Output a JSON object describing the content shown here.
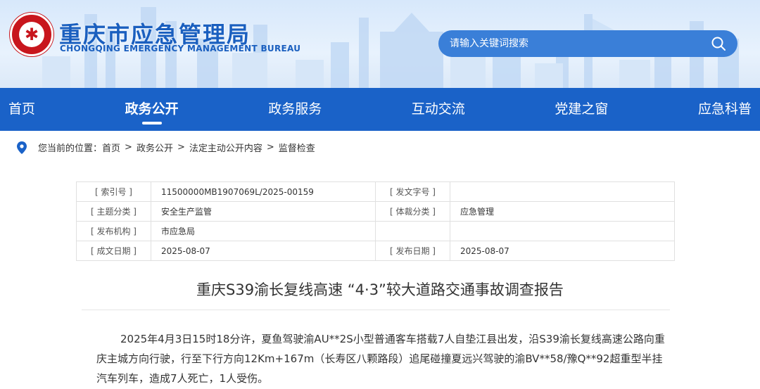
{
  "header": {
    "logo_icon": "emergency-management-emblem",
    "title": "重庆市应急管理局",
    "subtitle": "CHONGQING EMERGENCY MANAGEMENT BUREAU",
    "search_placeholder": "请输入关键词搜索",
    "search_icon": "search-icon"
  },
  "nav": {
    "items": [
      {
        "label": "首页"
      },
      {
        "label": "政务公开",
        "active": true
      },
      {
        "label": "政务服务"
      },
      {
        "label": "互动交流"
      },
      {
        "label": "党建之窗"
      },
      {
        "label": "应急科普"
      }
    ]
  },
  "breadcrumb": {
    "prefix": "您当前的位置：",
    "items": [
      "首页",
      "政务公开",
      "法定主动公开内容",
      "监督检查"
    ],
    "separator": ">"
  },
  "info": {
    "rows": [
      {
        "l1": "[ 索引号 ]",
        "v1": "11500000MB1907069L/2025-00159",
        "l2": "[ 发文字号 ]",
        "v2": ""
      },
      {
        "l1": "[ 主题分类 ]",
        "v1": "安全生产监管",
        "l2": "[ 体裁分类 ]",
        "v2": "应急管理"
      },
      {
        "l1": "[ 发布机构 ]",
        "v1": "市应急局",
        "l2": "",
        "v2": ""
      },
      {
        "l1": "[ 成文日期 ]",
        "v1": "2025-08-07",
        "l2": "[ 发布日期 ]",
        "v2": "2025-08-07"
      }
    ]
  },
  "article": {
    "title": "重庆S39渝长复线高速 “4·3”较大道路交通事故调查报告",
    "body": "2025年4月3日15时18分许，夏鱼驾驶渝AU**2S小型普通客车搭载7人自垫江县出发，沿S39渝长复线高速公路向重庆主城方向行驶，行至下行方向12Km+167m（长寿区八颗路段）追尾碰撞夏远兴驾驶的渝BV**58/豫Q**92超重型半挂汽车列车，造成7人死亡，1人受伤。"
  },
  "colors": {
    "brand_blue": "#1a62c8",
    "title_blue": "#1a5fbf",
    "emblem_red": "#c8161d"
  }
}
